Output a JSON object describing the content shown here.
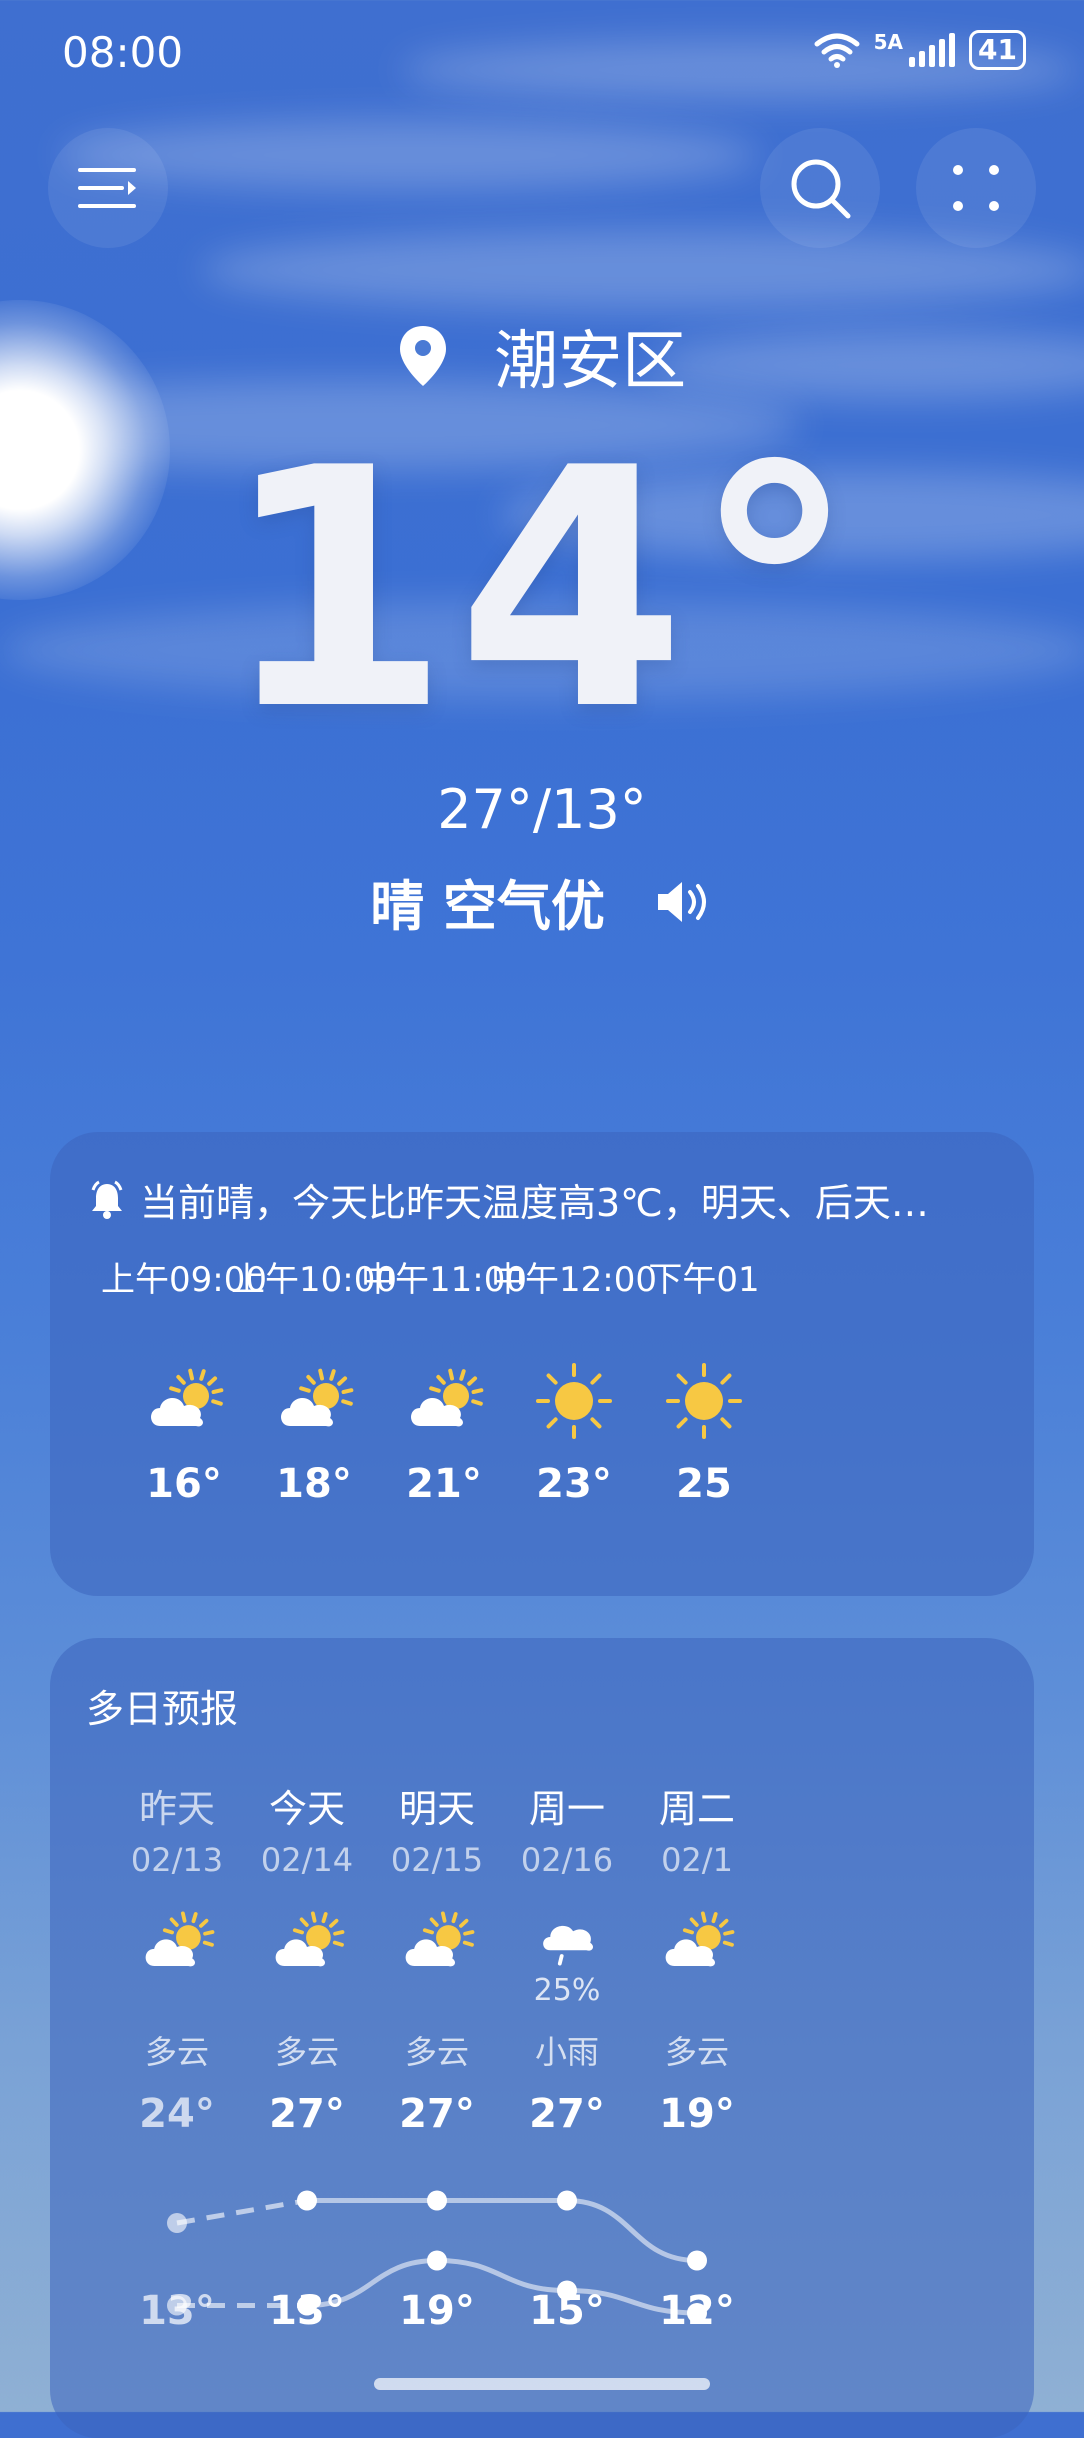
{
  "status_bar": {
    "time": "08:00",
    "network": "5A",
    "battery": "41"
  },
  "location": "潮安区",
  "current": {
    "temperature": "14°",
    "range": "27°/13°",
    "condition": "晴 空气优"
  },
  "hourly_card": {
    "alert": "当前晴，今天比昨天温度高3℃，明天、后天…",
    "hours": [
      {
        "label": "上午09:00",
        "icon": "partly-cloudy-icon",
        "temp": "16°"
      },
      {
        "label": "上午10:00",
        "icon": "partly-cloudy-icon",
        "temp": "18°"
      },
      {
        "label": "中午11:00",
        "icon": "partly-cloudy-icon",
        "temp": "21°"
      },
      {
        "label": "中午12:00",
        "icon": "sun-icon",
        "temp": "23°"
      },
      {
        "label": "下午01",
        "icon": "sun-icon",
        "temp": "25"
      }
    ]
  },
  "forecast_card": {
    "title": "多日预报",
    "days": [
      {
        "name": "昨天",
        "date": "02/13",
        "icon": "partly-cloudy-icon",
        "rain": "",
        "condition": "多云",
        "high": "24°",
        "low": "13°"
      },
      {
        "name": "今天",
        "date": "02/14",
        "icon": "partly-cloudy-icon",
        "rain": "",
        "condition": "多云",
        "high": "27°",
        "low": "13°"
      },
      {
        "name": "明天",
        "date": "02/15",
        "icon": "partly-cloudy-icon",
        "rain": "",
        "condition": "多云",
        "high": "27°",
        "low": "19°"
      },
      {
        "name": "周一",
        "date": "02/16",
        "icon": "rain-cloud-icon",
        "rain": "25%",
        "condition": "小雨",
        "high": "27°",
        "low": "15°"
      },
      {
        "name": "周二",
        "date": "02/1",
        "icon": "partly-cloudy-icon",
        "rain": "",
        "condition": "多云",
        "high": "19°",
        "low": "12°"
      }
    ]
  },
  "colors": {
    "sun": "#f7c843",
    "cloud": "#ffffff",
    "card": "#3c64be"
  }
}
